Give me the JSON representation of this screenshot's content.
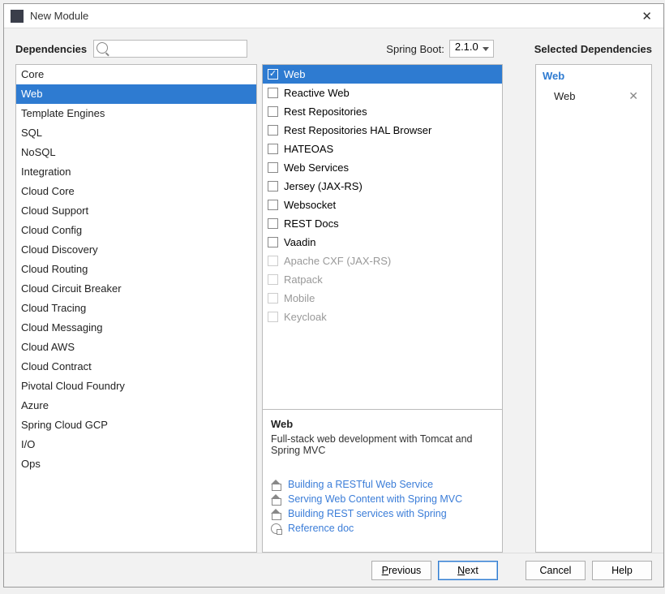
{
  "window": {
    "title": "New Module"
  },
  "header": {
    "dependencies_label": "Dependencies",
    "search_placeholder": "",
    "spring_boot_label": "Spring Boot:",
    "spring_boot_value": "2.1.0",
    "selected_label": "Selected Dependencies"
  },
  "categories": [
    "Core",
    "Web",
    "Template Engines",
    "SQL",
    "NoSQL",
    "Integration",
    "Cloud Core",
    "Cloud Support",
    "Cloud Config",
    "Cloud Discovery",
    "Cloud Routing",
    "Cloud Circuit Breaker",
    "Cloud Tracing",
    "Cloud Messaging",
    "Cloud AWS",
    "Cloud Contract",
    "Pivotal Cloud Foundry",
    "Azure",
    "Spring Cloud GCP",
    "I/O",
    "Ops"
  ],
  "category_selected_index": 1,
  "dependencies": [
    {
      "label": "Web",
      "checked": true,
      "selected": true,
      "disabled": false
    },
    {
      "label": "Reactive Web",
      "checked": false,
      "selected": false,
      "disabled": false
    },
    {
      "label": "Rest Repositories",
      "checked": false,
      "selected": false,
      "disabled": false
    },
    {
      "label": "Rest Repositories HAL Browser",
      "checked": false,
      "selected": false,
      "disabled": false
    },
    {
      "label": "HATEOAS",
      "checked": false,
      "selected": false,
      "disabled": false
    },
    {
      "label": "Web Services",
      "checked": false,
      "selected": false,
      "disabled": false
    },
    {
      "label": "Jersey (JAX-RS)",
      "checked": false,
      "selected": false,
      "disabled": false
    },
    {
      "label": "Websocket",
      "checked": false,
      "selected": false,
      "disabled": false
    },
    {
      "label": "REST Docs",
      "checked": false,
      "selected": false,
      "disabled": false
    },
    {
      "label": "Vaadin",
      "checked": false,
      "selected": false,
      "disabled": false
    },
    {
      "label": "Apache CXF (JAX-RS)",
      "checked": false,
      "selected": false,
      "disabled": true
    },
    {
      "label": "Ratpack",
      "checked": false,
      "selected": false,
      "disabled": true
    },
    {
      "label": "Mobile",
      "checked": false,
      "selected": false,
      "disabled": true
    },
    {
      "label": "Keycloak",
      "checked": false,
      "selected": false,
      "disabled": true
    }
  ],
  "description": {
    "title": "Web",
    "text": "Full-stack web development with Tomcat and Spring MVC",
    "guides": [
      "Building a RESTful Web Service",
      "Serving Web Content with Spring MVC",
      "Building REST services with Spring"
    ],
    "reference": "Reference doc"
  },
  "selected": {
    "group": "Web",
    "items": [
      "Web"
    ]
  },
  "buttons": {
    "previous": "Previous",
    "next": "Next",
    "cancel": "Cancel",
    "help": "Help"
  }
}
